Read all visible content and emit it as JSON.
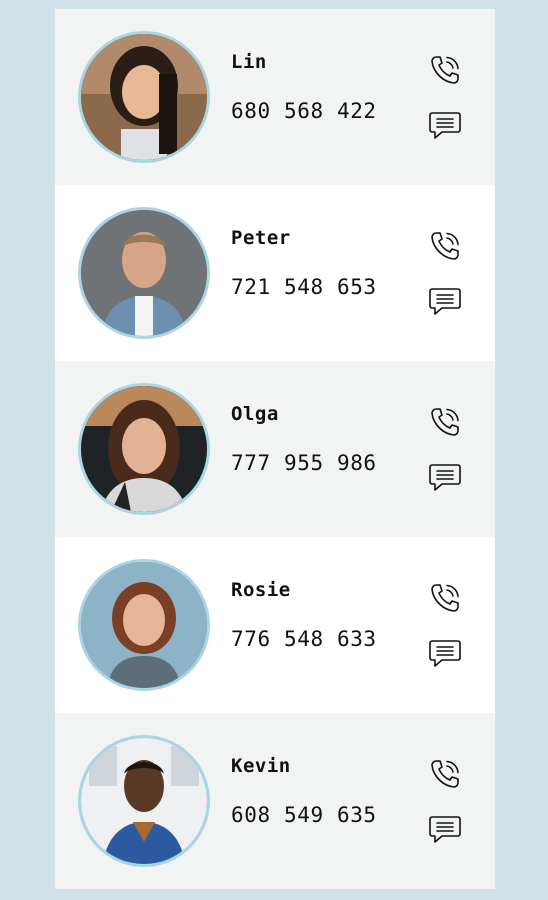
{
  "contacts": [
    {
      "name": "Lin",
      "phone": "680 568 422",
      "avatar": "avatar-lin"
    },
    {
      "name": "Peter",
      "phone": "721 548 653",
      "avatar": "avatar-peter"
    },
    {
      "name": "Olga",
      "phone": "777 955 986",
      "avatar": "avatar-olga"
    },
    {
      "name": "Rosie",
      "phone": "776 548 633",
      "avatar": "avatar-rosie"
    },
    {
      "name": "Kevin",
      "phone": "608 549 635",
      "avatar": "avatar-kevin"
    }
  ],
  "icons": {
    "call": "phone-call-icon",
    "message": "message-icon"
  },
  "colors": {
    "background": "#d1e1e8",
    "row_alt": "#f2f4f4",
    "avatar_border": "#a9d6e4"
  }
}
